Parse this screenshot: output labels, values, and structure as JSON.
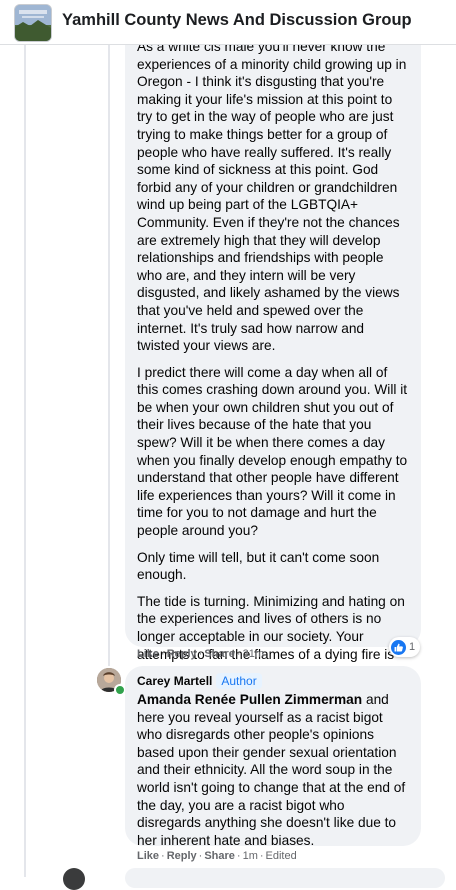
{
  "header": {
    "group_title": "Yamhill County News And Discussion Group"
  },
  "comment1": {
    "paragraphs": [
      "As a white cis male you'll never know the experiences of a minority child growing up in Oregon - I think it's disgusting that you're making it your life's mission at this point to try to get in the way of people who are just trying to make things better for a group of people who have really suffered. It's really some kind of sickness at this point. God forbid any of your children or grandchildren wind up being part of the LGBTQIA+ Community. Even if they're not the chances are extremely high that they will develop relationships and friendships with people who are, and they intern will be very disgusted, and likely ashamed by the views that you've held and spewed over the internet. It's truly sad how narrow and twisted your views are.",
      "I predict there will come a day when all of this comes crashing down around you. Will it be when your own children shut you out of their lives because of the hate that you spew? Will it be when there comes a day when you finally develop enough empathy to understand that other people have different life experiences than yours? Will it come in time for you to not damage and hurt the people around you?",
      "Only time will tell, but it can't come soon enough.",
      "The tide is turning. Minimizing and hating on the experiences and lives of others is no longer acceptable in our society. Your attempts to fan the flames of a dying fire is painfully obvious and it's not working."
    ],
    "actions": {
      "like": "Like",
      "reply": "Reply",
      "share": "Share",
      "time": "31m"
    },
    "reaction_count": "1"
  },
  "comment2": {
    "author": "Carey Martell",
    "author_badge": "Author",
    "mention": "Amanda Renée Pullen Zimmerman",
    "text": " and here you reveal yourself as a racist bigot who disregards other people's opinions based upon their gender sexual orientation and their ethnicity. All the word soup in the world isn't going to change that at the end of the day, you are a racist bigot who disregards anything she doesn't like due to her inherent hate and biases.",
    "actions": {
      "like": "Like",
      "reply": "Reply",
      "share": "Share",
      "time": "1m",
      "edited": "Edited"
    }
  },
  "icons": [
    "group-thumbnail",
    "like-icon",
    "avatar",
    "online-status-icon"
  ],
  "colors": {
    "accent": "#1877f2",
    "bubble": "#f0f2f5",
    "meta": "#65676b",
    "online": "#31a24c"
  }
}
